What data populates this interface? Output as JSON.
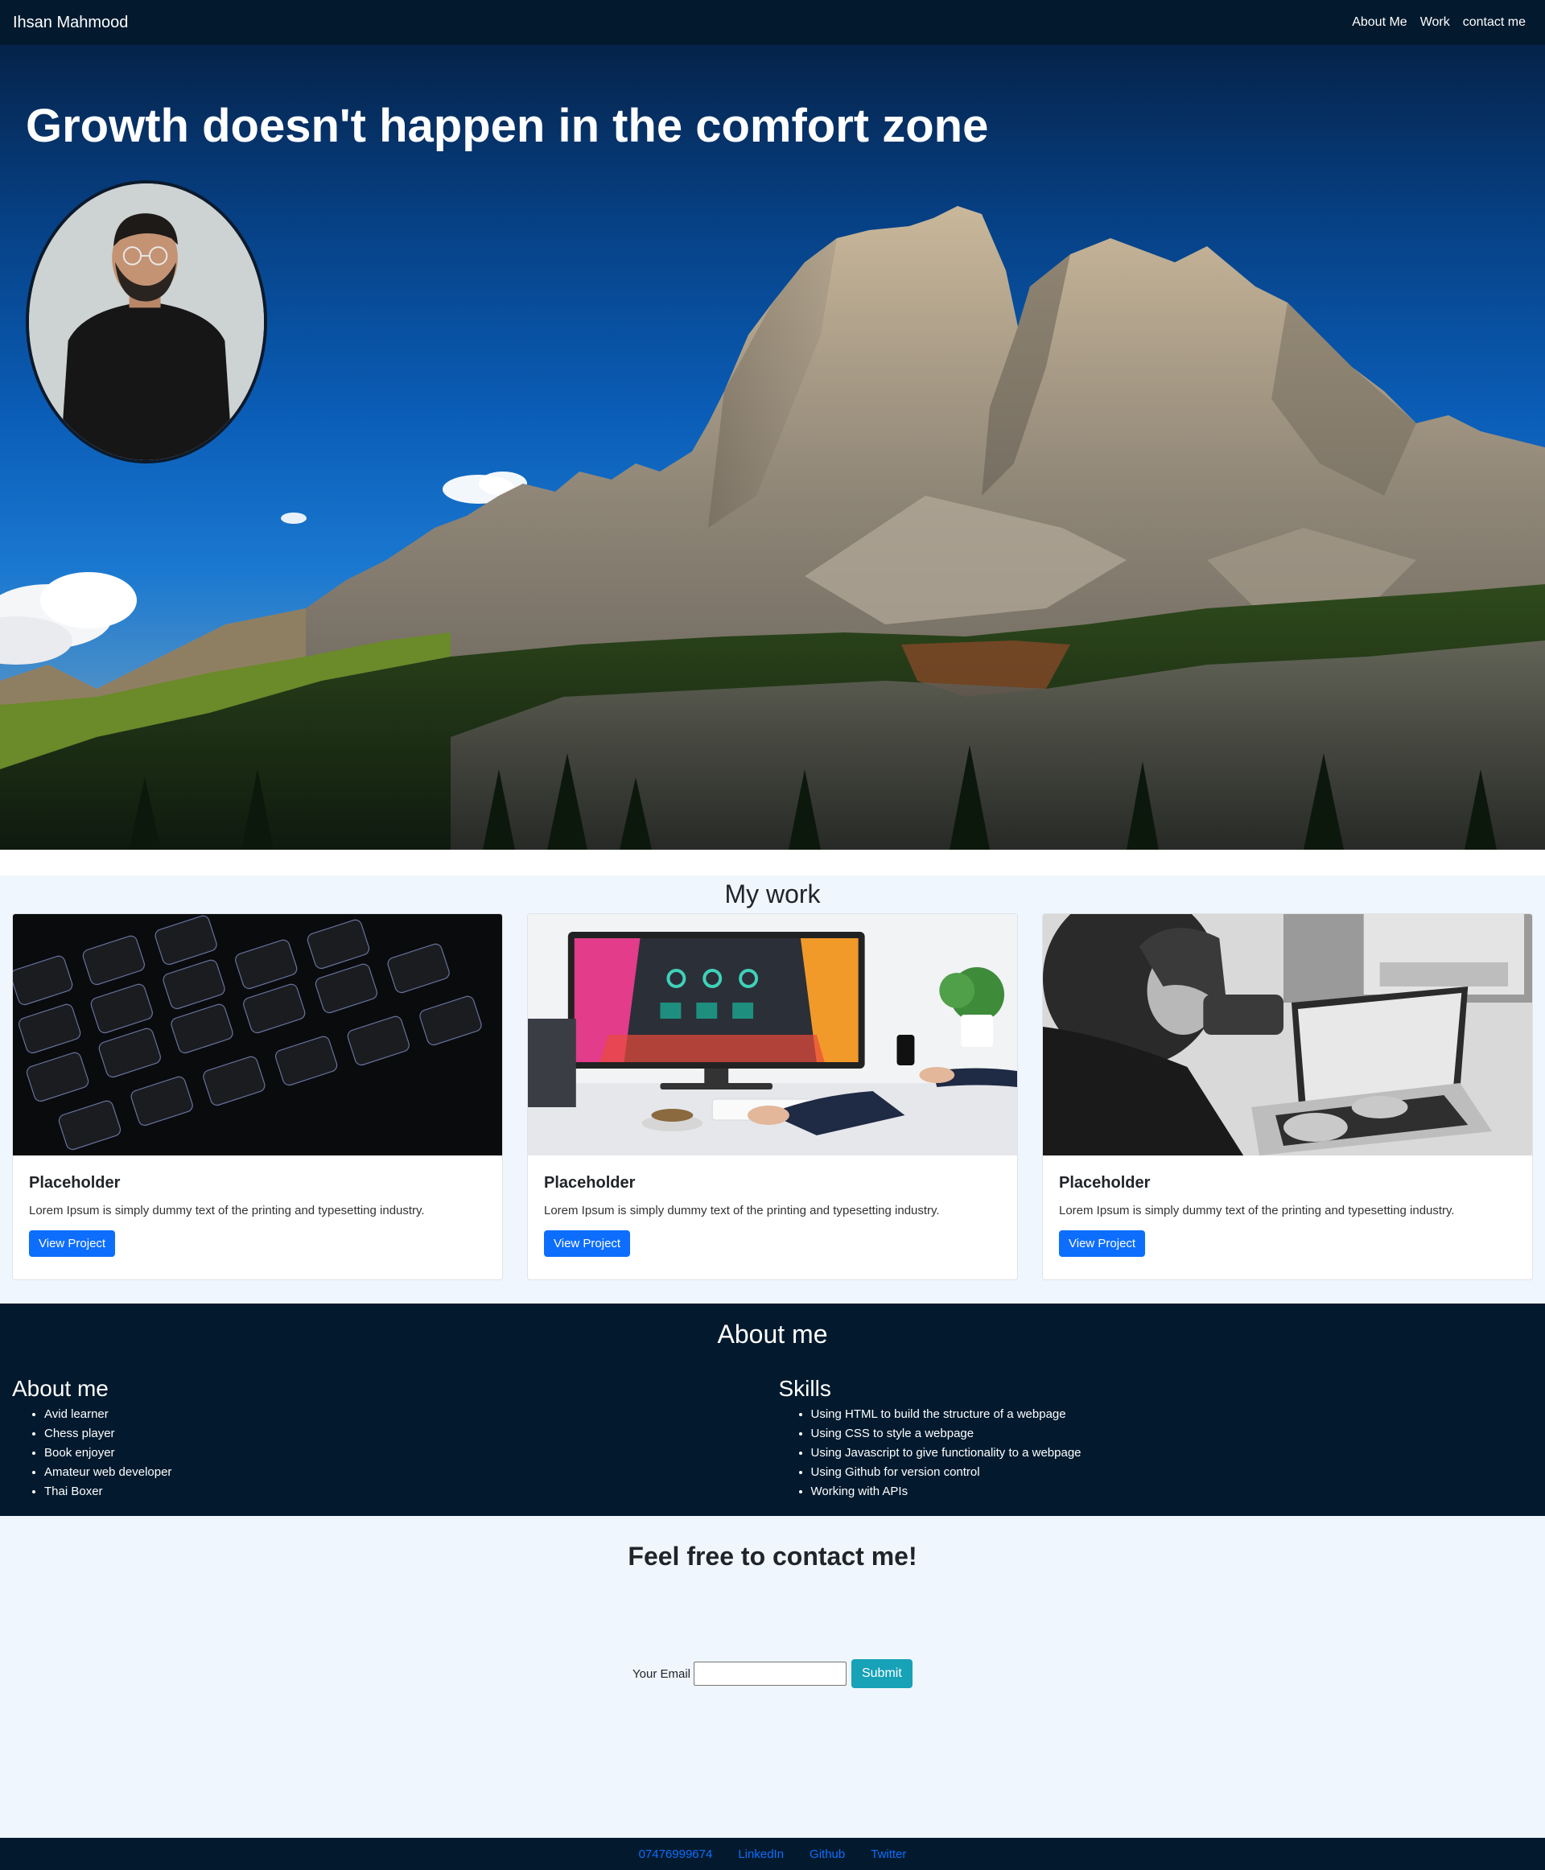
{
  "nav": {
    "brand": "Ihsan Mahmood",
    "links": [
      "About Me",
      "Work",
      "contact me"
    ]
  },
  "hero": {
    "title": "Growth doesn't happen in the comfort zone"
  },
  "work": {
    "title": "My work",
    "cards": [
      {
        "title": "Placeholder",
        "text": "Lorem Ipsum is simply dummy text of the printing and typesetting industry.",
        "button": "View Project"
      },
      {
        "title": "Placeholder",
        "text": "Lorem Ipsum is simply dummy text of the printing and typesetting industry.",
        "button": "View Project"
      },
      {
        "title": "Placeholder",
        "text": "Lorem Ipsum is simply dummy text of the printing and typesetting industry.",
        "button": "View Project"
      }
    ]
  },
  "about": {
    "title": "About me",
    "left": {
      "heading": "About me",
      "items": [
        "Avid learner",
        "Chess player",
        "Book enjoyer",
        "Amateur web developer",
        "Thai Boxer"
      ]
    },
    "right": {
      "heading": "Skills",
      "items": [
        "Using HTML to build the structure of a webpage",
        "Using CSS to style a webpage",
        "Using Javascript to give functionality to a webpage",
        "Using Github for version control",
        "Working with APIs"
      ]
    }
  },
  "contact": {
    "title": "Feel free to contact me!",
    "email_label": "Your Email",
    "email_value": "",
    "submit": "Submit"
  },
  "footer": {
    "links": [
      "07476999674",
      "LinkedIn",
      "Github",
      "Twitter"
    ]
  },
  "colors": {
    "navy": "#031a2e",
    "light_bg": "#f0f6fd",
    "primary": "#0d6efd",
    "info": "#17a2b8"
  }
}
